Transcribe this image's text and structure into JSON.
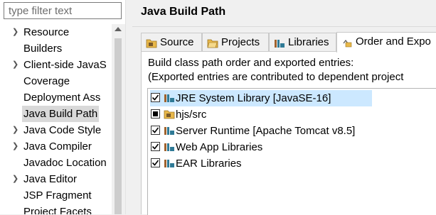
{
  "filter": {
    "placeholder": "type filter text"
  },
  "tree": {
    "items": [
      {
        "label": "Resource",
        "expandable": true
      },
      {
        "label": "Builders",
        "expandable": false
      },
      {
        "label": "Client-side JavaS",
        "expandable": true
      },
      {
        "label": "Coverage",
        "expandable": false
      },
      {
        "label": "Deployment Ass",
        "expandable": false
      },
      {
        "label": "Java Build Path",
        "expandable": false,
        "selected": true
      },
      {
        "label": "Java Code Style",
        "expandable": true
      },
      {
        "label": "Java Compiler",
        "expandable": true
      },
      {
        "label": "Javadoc Location",
        "expandable": false
      },
      {
        "label": "Java Editor",
        "expandable": true
      },
      {
        "label": "JSP Fragment",
        "expandable": false
      },
      {
        "label": "Project Facets",
        "expandable": false
      }
    ]
  },
  "page": {
    "title": "Java Build Path",
    "tabs": [
      {
        "label": "Source",
        "icon": "source-folder-icon"
      },
      {
        "label": "Projects",
        "icon": "projects-icon"
      },
      {
        "label": "Libraries",
        "icon": "libraries-icon"
      },
      {
        "label": "Order and Expo",
        "icon": "order-export-icon",
        "active": true
      }
    ],
    "description_line1": "Build class path order and exported entries:",
    "description_line2": "(Exported entries are contributed to dependent project",
    "entries": [
      {
        "label": "JRE System Library [JavaSE-16]",
        "state": "checked",
        "icon": "library-icon",
        "selected": true
      },
      {
        "label": "hjs/src",
        "state": "partial",
        "icon": "package-folder-icon"
      },
      {
        "label": "Server Runtime [Apache Tomcat v8.5]",
        "state": "checked",
        "icon": "library-icon"
      },
      {
        "label": "Web App Libraries",
        "state": "checked",
        "icon": "library-icon"
      },
      {
        "label": "EAR Libraries",
        "state": "checked",
        "icon": "library-icon"
      }
    ]
  },
  "colors": {
    "selection": "#cce8ff",
    "tree_selection": "#d9d9d9",
    "library_icon_brown": "#a0622d",
    "library_icon_teal": "#2f7a96",
    "folder_yellow": "#e8b84a"
  }
}
